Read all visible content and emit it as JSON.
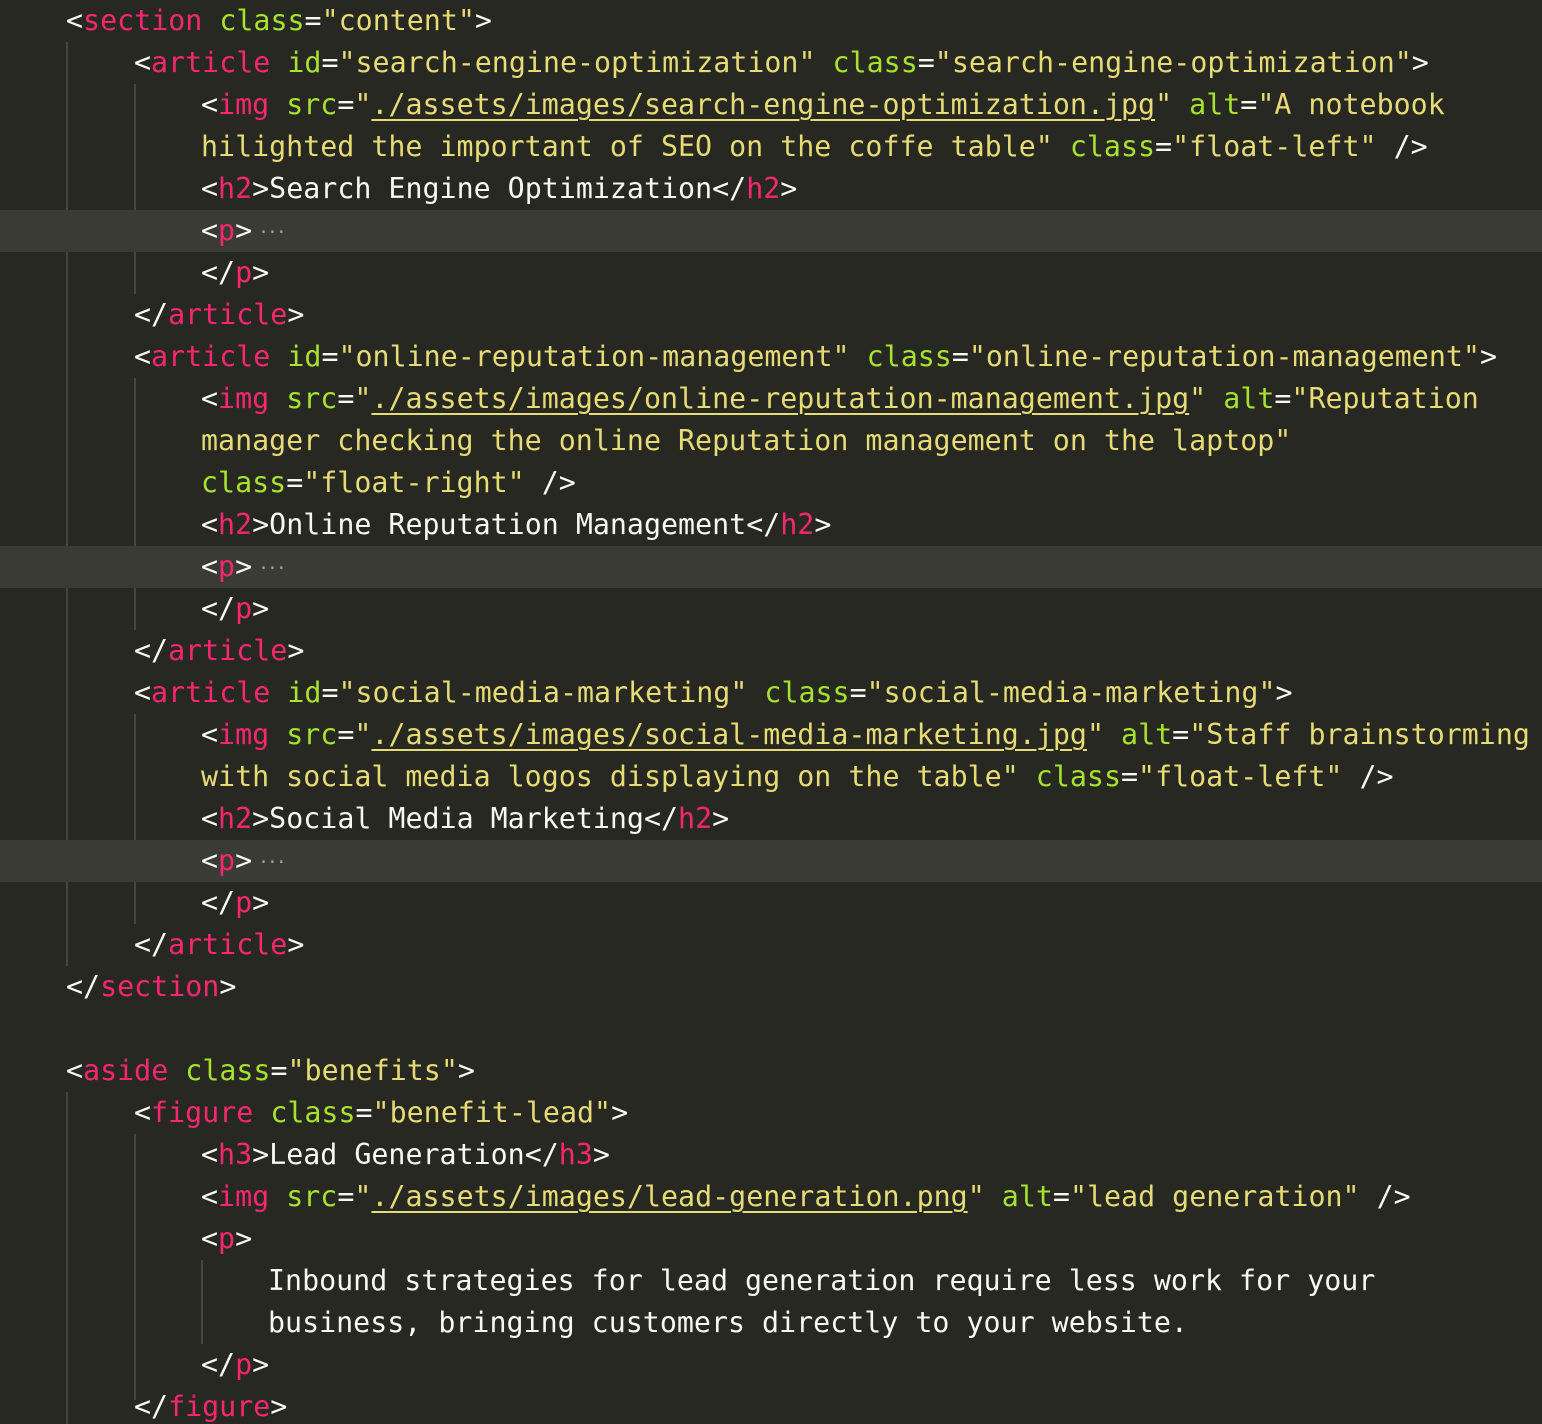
{
  "editor": {
    "folded_marker": "···"
  },
  "tags": {
    "section": "section",
    "article": "article",
    "img": "img",
    "h2": "h2",
    "h3": "h3",
    "p": "p",
    "aside": "aside",
    "figure": "figure"
  },
  "attrs": {
    "class": "class",
    "id": "id",
    "src": "src",
    "alt": "alt"
  },
  "section": {
    "class_value": "\"content\""
  },
  "articles": [
    {
      "id_value": "\"search-engine-optimization\"",
      "class_value": "\"search-engine-optimization\"",
      "img_src": "./assets/images/search-engine-optimization.jpg",
      "alt_part1": "\"A notebook",
      "alt_part2": "hilighted the important of SEO on the coffe table\"",
      "img_class": "\"float-left\"",
      "heading": "Search Engine Optimization"
    },
    {
      "id_value": "\"online-reputation-management\"",
      "class_value": "\"online-reputation-management\"",
      "img_src": "./assets/images/online-reputation-management.jpg",
      "alt_part1": "\"Reputation",
      "alt_part2": "manager checking the online Reputation management on the laptop\"",
      "img_class": "\"float-right\"",
      "heading": "Online Reputation Management"
    },
    {
      "id_value": "\"social-media-marketing\"",
      "class_value": "\"social-media-marketing\"",
      "img_src": "./assets/images/social-media-marketing.jpg",
      "alt_part1": "\"Staff brainstorming",
      "alt_part2": "with social media logos displaying on the table\"",
      "img_class": "\"float-left\"",
      "heading": "Social Media Marketing"
    }
  ],
  "aside": {
    "class_value": "\"benefits\"",
    "figure_class": "\"benefit-lead\"",
    "heading": "Lead Generation",
    "img_src": "./assets/images/lead-generation.png",
    "img_alt": "\"lead generation\"",
    "para_line1": "Inbound strategies for lead generation require less work for your",
    "para_line2": "business, bringing customers directly to your website."
  }
}
